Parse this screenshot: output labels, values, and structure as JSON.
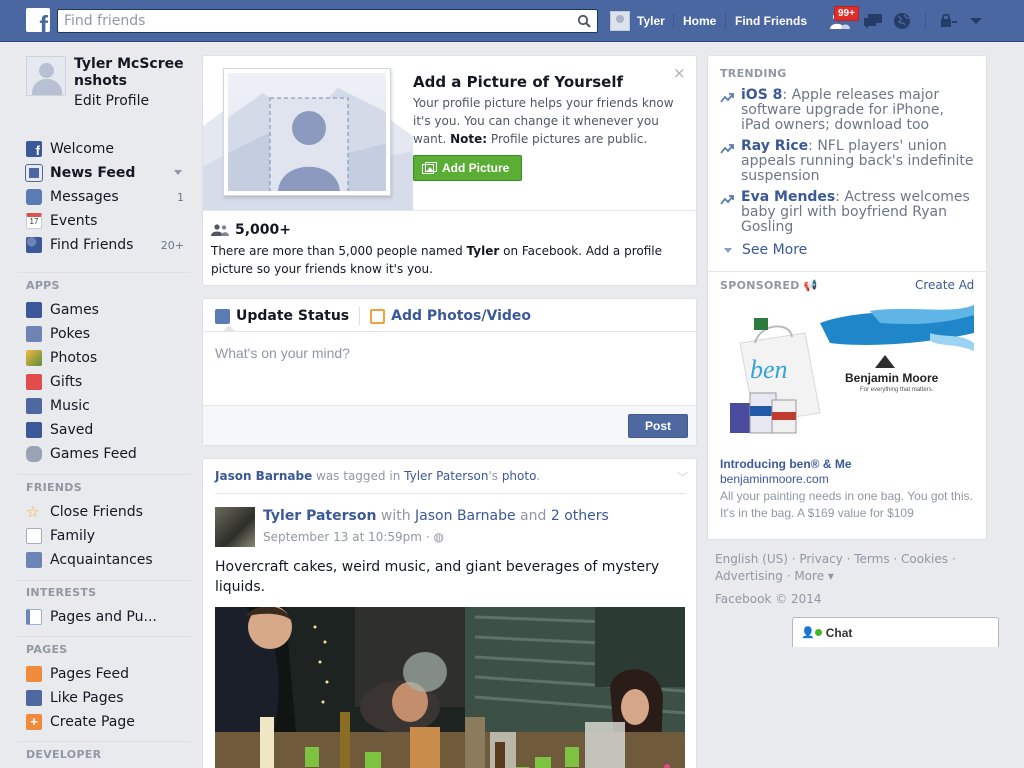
{
  "topbar": {
    "logo": "f",
    "search_placeholder": "Find friends",
    "user_name": "Tyler",
    "home": "Home",
    "find_friends": "Find Friends",
    "notif_badge": "99+",
    "icons": [
      "friend-requests-icon",
      "messages-icon",
      "notifications-globe-icon",
      "privacy-lock-icon",
      "account-menu-icon"
    ],
    "bar_color": "#4b67a1"
  },
  "sidebar": {
    "profile_name": "Tyler McScreenshots",
    "edit_profile": "Edit Profile",
    "favorites": [
      {
        "label": "Welcome",
        "count": "",
        "icon": "facebook-icon"
      },
      {
        "label": "News Feed",
        "count": "",
        "icon": "news-feed-icon"
      },
      {
        "label": "Messages",
        "count": "1",
        "icon": "messages-icon"
      },
      {
        "label": "Events",
        "count": "",
        "icon": "calendar-icon",
        "icon_text": "17"
      },
      {
        "label": "Find Friends",
        "count": "20+",
        "icon": "find-friends-icon"
      }
    ],
    "apps_title": "APPS",
    "apps": [
      {
        "label": "Games",
        "icon": "games-icon"
      },
      {
        "label": "Pokes",
        "icon": "pokes-icon"
      },
      {
        "label": "Photos",
        "icon": "photos-icon"
      },
      {
        "label": "Gifts",
        "icon": "gifts-icon"
      },
      {
        "label": "Music",
        "icon": "music-icon"
      },
      {
        "label": "Saved",
        "icon": "saved-icon"
      },
      {
        "label": "Games Feed",
        "icon": "games-feed-icon"
      }
    ],
    "friends_title": "FRIENDS",
    "friends": [
      {
        "label": "Close Friends",
        "icon": "star-icon"
      },
      {
        "label": "Family",
        "icon": "family-icon"
      },
      {
        "label": "Acquaintances",
        "icon": "acquaintances-icon"
      }
    ],
    "interests_title": "INTERESTS",
    "interests": [
      {
        "label": "Pages and Pu...",
        "icon": "interests-list-icon"
      }
    ],
    "pages_title": "PAGES",
    "pages": [
      {
        "label": "Pages Feed",
        "icon": "pages-feed-icon"
      },
      {
        "label": "Like Pages",
        "icon": "like-icon"
      },
      {
        "label": "Create Page",
        "icon": "create-page-icon"
      }
    ],
    "developer_title": "DEVELOPER"
  },
  "profile_prompt": {
    "title": "Add a Picture of Yourself",
    "desc": "Your profile picture helps your friends know it's you. You can change it whenever you want.",
    "note_label": "Note:",
    "note_text": "Profile pictures are public.",
    "button": "Add Picture",
    "close": "×",
    "count": "5,000+",
    "footer_pre": "There are more than 5,000 people named ",
    "footer_name": "Tyler",
    "footer_post": " on Facebook. Add a profile picture so your friends know it's you."
  },
  "composer": {
    "tab_status": "Update Status",
    "tab_photos": "Add Photos/Video",
    "placeholder": "What's on your mind?",
    "post_button": "Post"
  },
  "story": {
    "tagged_user": "Jason Barnabe",
    "tagged_text": " was tagged in ",
    "owner": "Tyler Paterson",
    "owner_suffix": "'s ",
    "photo_word": "photo",
    "period": ".",
    "author": "Tyler Paterson",
    "with": " with ",
    "with_user": "Jason Barnabe",
    "and": " and ",
    "others": "2 others",
    "timestamp": "September 13 at 10:59pm",
    "dot": " · ",
    "text": "Hovercraft cakes, weird music, and giant beverages of mystery liquids."
  },
  "trending": {
    "title": "TRENDING",
    "items": [
      {
        "topic": "iOS 8",
        "desc": ": Apple releases major software upgrade for iPhone, iPad owners; download too"
      },
      {
        "topic": "Ray Rice",
        "desc": ": NFL players' union appeals running back's indefinite suspension"
      },
      {
        "topic": "Eva Mendes",
        "desc": ": Actress welcomes baby girl with boyfriend Ryan Gosling"
      }
    ],
    "see_more": "See More"
  },
  "sponsored": {
    "title": "SPONSORED",
    "create_ad": "Create Ad",
    "brand": "Benjamin Moore",
    "brand_tagline": "For everything that matters.",
    "bag_text": "ben",
    "ad_title": "Introducing ben® & Me",
    "ad_url": "benjaminmoore.com",
    "ad_desc": "All your painting needs in one bag. You got this. It's in the bag. A $169 value for $109"
  },
  "footer": {
    "links": "English (US) · Privacy · Terms · Cookies · Advertising · More ▾",
    "copyright": "Facebook © 2014"
  },
  "chat": {
    "label": "Chat"
  }
}
